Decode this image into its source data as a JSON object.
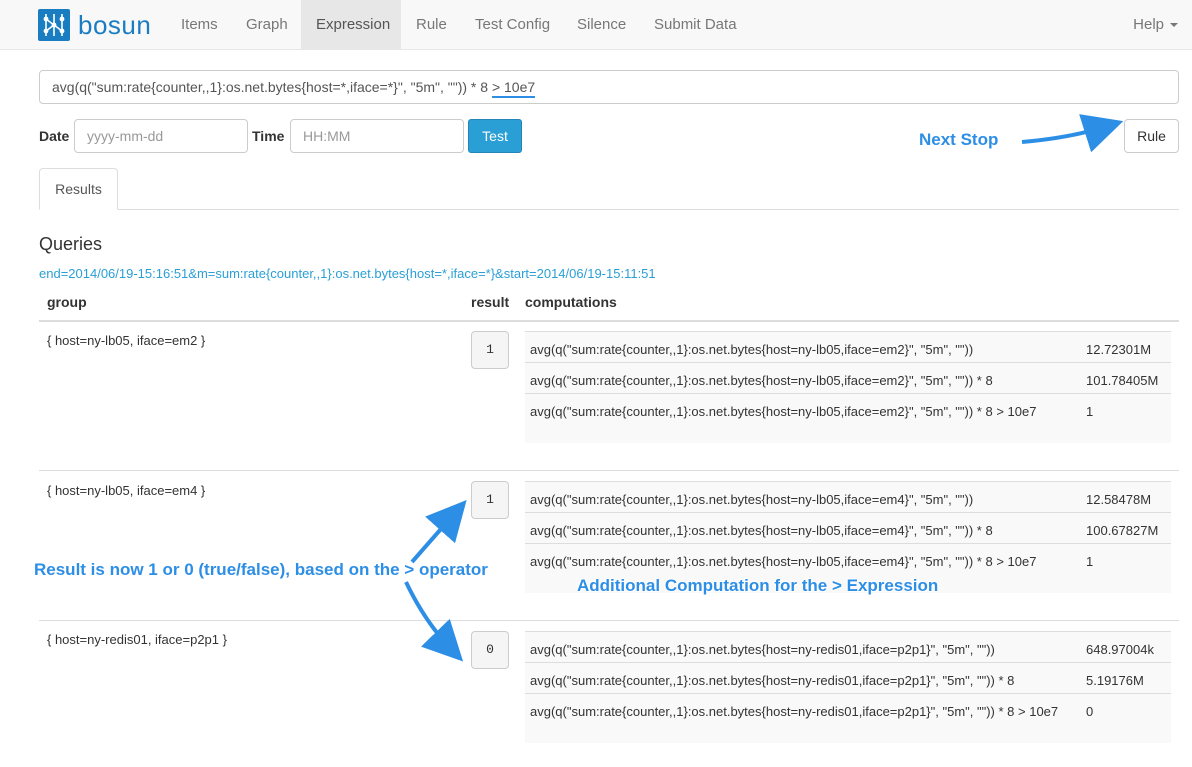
{
  "nav": {
    "brand": "bosun",
    "items": [
      "Items",
      "Graph",
      "Expression",
      "Rule",
      "Test Config",
      "Silence",
      "Submit Data"
    ],
    "active": "Expression",
    "help": "Help"
  },
  "expression": {
    "text_main": "avg(q(\"sum:rate{counter,,1}:os.net.bytes{host=*,iface=*}\", \"5m\", \"\")) * 8 ",
    "text_highlight": "> 10e7"
  },
  "form": {
    "date_label": "Date",
    "date_placeholder": "yyyy-mm-dd",
    "time_label": "Time",
    "time_placeholder": "HH:MM",
    "test_button": "Test",
    "rule_button": "Rule"
  },
  "tabs": [
    "Results"
  ],
  "queries": {
    "title": "Queries",
    "link": "end=2014/06/19-15:16:51&m=sum:rate{counter,,1}:os.net.bytes{host=*,iface=*}&start=2014/06/19-15:11:51",
    "headers": {
      "group": "group",
      "result": "result",
      "computations": "computations"
    },
    "rows": [
      {
        "group": "{ host=ny-lb05, iface=em2 }",
        "result": "1",
        "computations": [
          {
            "expr": "avg(q(\"sum:rate{counter,,1}:os.net.bytes{host=ny-lb05,iface=em2}\", \"5m\", \"\"))",
            "value": "12.72301M"
          },
          {
            "expr": "avg(q(\"sum:rate{counter,,1}:os.net.bytes{host=ny-lb05,iface=em2}\", \"5m\", \"\")) * 8",
            "value": "101.78405M"
          },
          {
            "expr": "avg(q(\"sum:rate{counter,,1}:os.net.bytes{host=ny-lb05,iface=em2}\", \"5m\", \"\")) * 8 > 10e7",
            "value": "1"
          }
        ]
      },
      {
        "group": "{ host=ny-lb05, iface=em4 }",
        "result": "1",
        "computations": [
          {
            "expr": "avg(q(\"sum:rate{counter,,1}:os.net.bytes{host=ny-lb05,iface=em4}\", \"5m\", \"\"))",
            "value": "12.58478M"
          },
          {
            "expr": "avg(q(\"sum:rate{counter,,1}:os.net.bytes{host=ny-lb05,iface=em4}\", \"5m\", \"\")) * 8",
            "value": "100.67827M"
          },
          {
            "expr": "avg(q(\"sum:rate{counter,,1}:os.net.bytes{host=ny-lb05,iface=em4}\", \"5m\", \"\")) * 8 > 10e7",
            "value": "1"
          }
        ]
      },
      {
        "group": "{ host=ny-redis01, iface=p2p1 }",
        "result": "0",
        "computations": [
          {
            "expr": "avg(q(\"sum:rate{counter,,1}:os.net.bytes{host=ny-redis01,iface=p2p1}\", \"5m\", \"\"))",
            "value": "648.97004k"
          },
          {
            "expr": "avg(q(\"sum:rate{counter,,1}:os.net.bytes{host=ny-redis01,iface=p2p1}\", \"5m\", \"\")) * 8",
            "value": "5.19176M"
          },
          {
            "expr": "avg(q(\"sum:rate{counter,,1}:os.net.bytes{host=ny-redis01,iface=p2p1}\", \"5m\", \"\")) * 8 > 10e7",
            "value": "0"
          }
        ]
      }
    ]
  },
  "annotations": {
    "next_stop": "Next Stop",
    "result_note": "Result is now 1 or 0 (true/false), based on the > operator",
    "computation_note": "Additional Computation for the > Expression"
  },
  "colors": {
    "brand": "#1b7dc1",
    "primary": "#2a9fd6",
    "annotation": "#2d8ee6"
  },
  "icons": [
    "bosun-logo-icon",
    "chevron-down-icon"
  ]
}
